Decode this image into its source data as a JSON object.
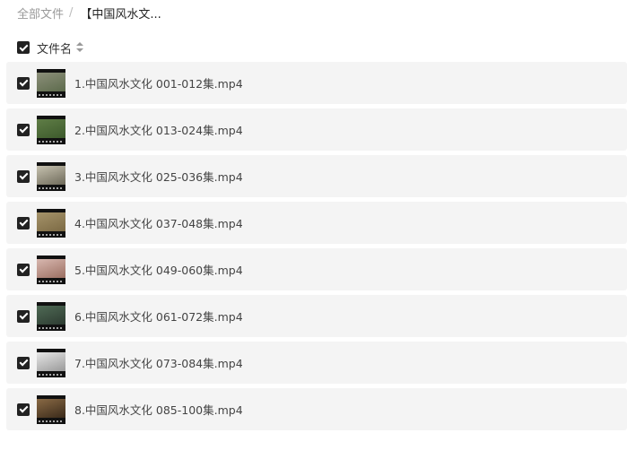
{
  "breadcrumb": {
    "root": "全部文件",
    "separator": "/",
    "current": "【中国风水文..."
  },
  "header": {
    "column_label": "文件名",
    "sort_icon": "sort-icon"
  },
  "files": [
    {
      "name": "1.中国风水文化 001-012集.mp4",
      "thumb_colors": [
        "#8c8f7a",
        "#5d6b4c"
      ]
    },
    {
      "name": "2.中国风水文化 013-024集.mp4",
      "thumb_colors": [
        "#5f7d46",
        "#3d5a2c"
      ]
    },
    {
      "name": "3.中国风水文化 025-036集.mp4",
      "thumb_colors": [
        "#c7c2b0",
        "#6e6a5a"
      ]
    },
    {
      "name": "4.中国风水文化 037-048集.mp4",
      "thumb_colors": [
        "#a5936a",
        "#7c6a44"
      ]
    },
    {
      "name": "5.中国风水文化 049-060集.mp4",
      "thumb_colors": [
        "#d8b8b0",
        "#9c6f62"
      ]
    },
    {
      "name": "6.中国风水文化 061-072集.mp4",
      "thumb_colors": [
        "#4f6a55",
        "#2d3b31"
      ]
    },
    {
      "name": "7.中国风水文化 073-084集.mp4",
      "thumb_colors": [
        "#e6e6e6",
        "#9a9a9a"
      ]
    },
    {
      "name": "8.中国风水文化 085-100集.mp4",
      "thumb_colors": [
        "#8a6a45",
        "#3a2a1a"
      ]
    }
  ]
}
